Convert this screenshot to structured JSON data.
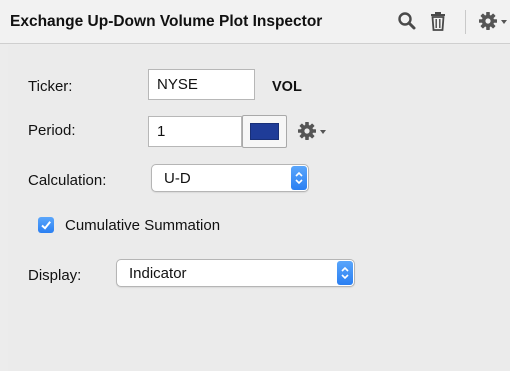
{
  "header": {
    "title": "Exchange Up-Down Volume Plot Inspector",
    "icons": [
      "search-icon",
      "trash-icon",
      "gear-menu-icon"
    ]
  },
  "form": {
    "ticker_label": "Ticker:",
    "ticker_value": "NYSE",
    "ticker_suffix": "VOL",
    "period_label": "Period:",
    "period_value": "1",
    "color": "#1f3c98",
    "calculation_label": "Calculation:",
    "calculation_value": "U-D",
    "cumulative_label": "Cumulative Summation",
    "cumulative_checked": true,
    "display_label": "Display:",
    "display_value": "Indicator"
  },
  "colors": {
    "accent": "#2a7ff2",
    "swatch": "#1f3c98"
  }
}
